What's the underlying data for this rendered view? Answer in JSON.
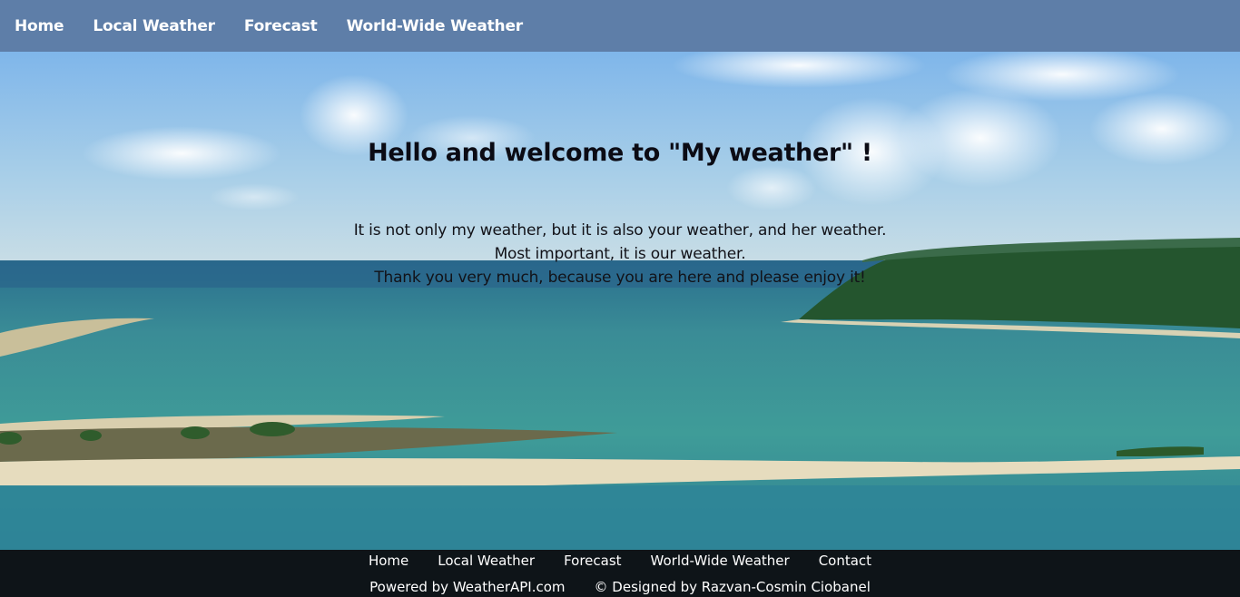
{
  "top_nav": {
    "items": [
      {
        "label": "Home"
      },
      {
        "label": "Local Weather"
      },
      {
        "label": "Forecast"
      },
      {
        "label": "World-Wide Weather"
      }
    ]
  },
  "hero": {
    "title": "Hello and welcome to \"My weather\" !",
    "lines": [
      "It is not only my weather, but it is also your weather, and her weather.",
      "Most important, it is our weather.",
      "Thank you very much, because you are here and please enjoy it!"
    ]
  },
  "footer": {
    "nav": [
      {
        "label": "Home"
      },
      {
        "label": "Local Weather"
      },
      {
        "label": "Forecast"
      },
      {
        "label": "World-Wide Weather"
      },
      {
        "label": "Contact"
      }
    ],
    "powered_by": "Powered by WeatherAPI.com",
    "designed_by": "© Designed by Razvan-Cosmin Ciobanel"
  },
  "colors": {
    "nav_bg": "#5e7ea8",
    "footer_bg": "#0e1418",
    "sky": "#8cbde6",
    "sea": "#2e8e8e"
  }
}
